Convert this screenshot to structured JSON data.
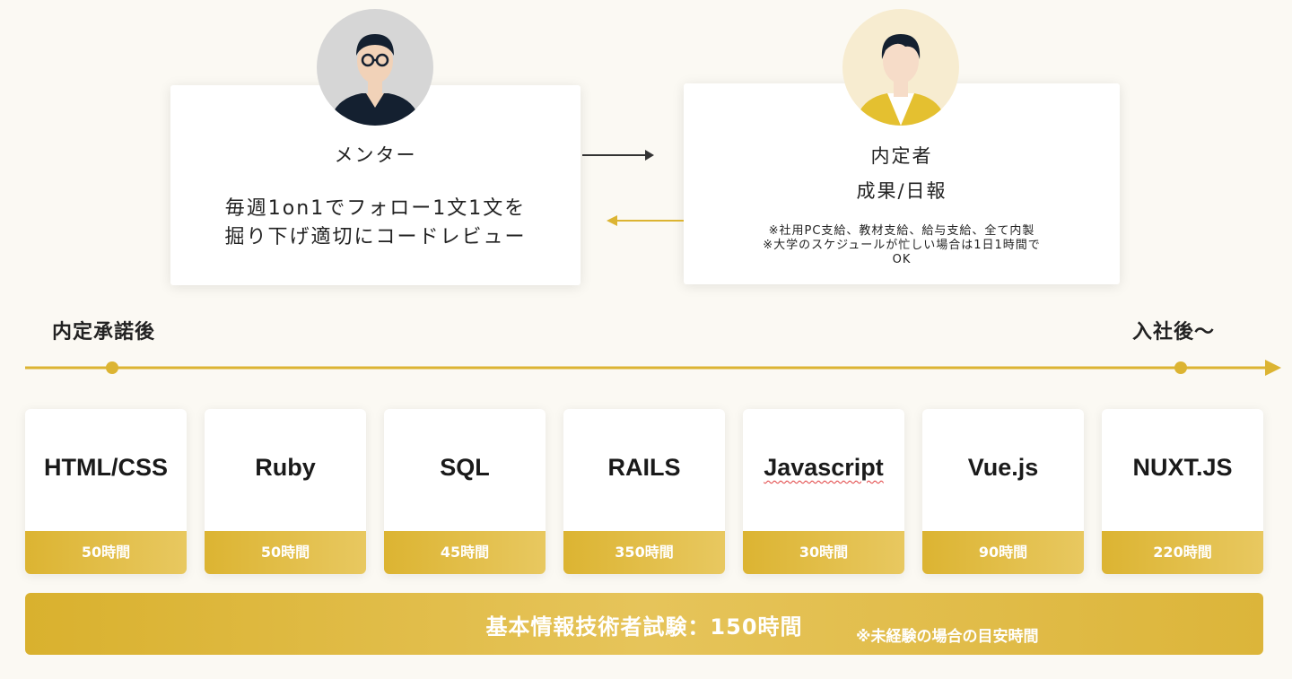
{
  "mentor": {
    "role": "メンター",
    "description_line1": "毎週1on1でフォロー1文1文を",
    "description_line2": "掘り下げ適切にコードレビュー"
  },
  "trainee": {
    "role": "内定者",
    "output": "成果/日報",
    "note_line1": "※社用PC支給、教材支給、給与支給、全て内製",
    "note_line2": "※大学のスケジュールが忙しい場合は1日1時間で",
    "note_line3": "OK"
  },
  "timeline": {
    "start_label": "内定承諾後",
    "end_label": "入社後〜"
  },
  "skills": [
    {
      "name": "HTML/CSS",
      "hours": "50時間"
    },
    {
      "name": "Ruby",
      "hours": "50時間"
    },
    {
      "name": "SQL",
      "hours": "45時間"
    },
    {
      "name": "RAILS",
      "hours": "350時間"
    },
    {
      "name": "Javascript",
      "hours": "30時間"
    },
    {
      "name": "Vue.js",
      "hours": "90時間"
    },
    {
      "name": "NUXT.JS",
      "hours": "220時間"
    }
  ],
  "exam": {
    "title": "基本情報技術者試験：150時間",
    "note": "※未経験の場合の目安時間"
  },
  "colors": {
    "accent": "#dcb432",
    "background": "#fbf9f3",
    "dark_arrow": "#333333"
  }
}
